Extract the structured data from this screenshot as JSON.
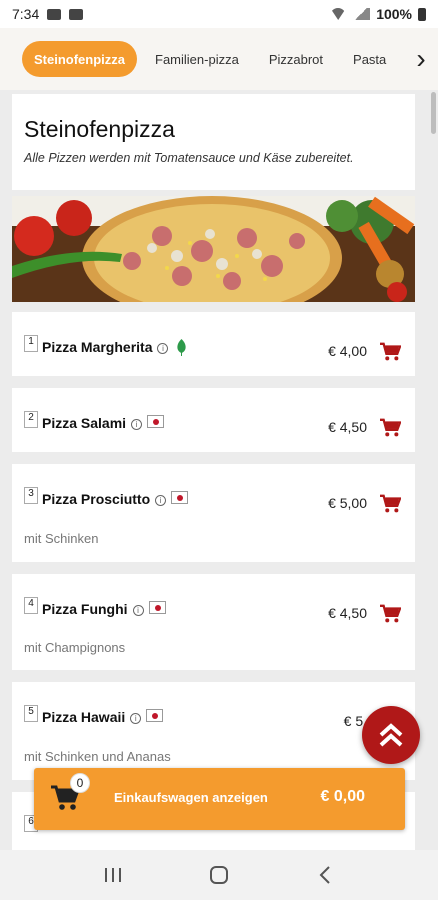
{
  "status": {
    "time": "7:34",
    "battery": "100%"
  },
  "tabs": [
    {
      "label": "Steinofenpizza",
      "active": true
    },
    {
      "label": "Familien-pizza"
    },
    {
      "label": "Pizzabrot"
    },
    {
      "label": "Pasta"
    }
  ],
  "category": {
    "title": "Steinofenpizza",
    "description": "Alle Pizzen werden mit Tomatensauce und Käse zubereitet."
  },
  "items": [
    {
      "number": "1",
      "name": "Pizza Margherita",
      "price": "€ 4,00",
      "description": "",
      "badge": "veg-leaf-icon"
    },
    {
      "number": "2",
      "name": "Pizza Salami",
      "price": "€ 4,50",
      "description": "",
      "badge": "allergen-flag-icon"
    },
    {
      "number": "3",
      "name": "Pizza Prosciutto",
      "price": "€ 5,00",
      "description": "mit Schinken",
      "badge": "allergen-flag-icon"
    },
    {
      "number": "4",
      "name": "Pizza Funghi",
      "price": "€ 4,50",
      "description": "mit Champignons",
      "badge": "allergen-flag-icon"
    },
    {
      "number": "5",
      "name": "Pizza Hawaii",
      "price": "€ 5,",
      "description": "mit Schinken und Ananas",
      "badge": "allergen-flag-icon"
    },
    {
      "number": "6",
      "name": "",
      "price": "",
      "description": "",
      "badge": ""
    }
  ],
  "cart": {
    "count": "0",
    "label": "Einkaufswagen anzeigen",
    "total": "€ 0,00"
  },
  "colors": {
    "accent": "#f49b2e",
    "fab": "#b01818",
    "cart_icon": "#b01818"
  }
}
